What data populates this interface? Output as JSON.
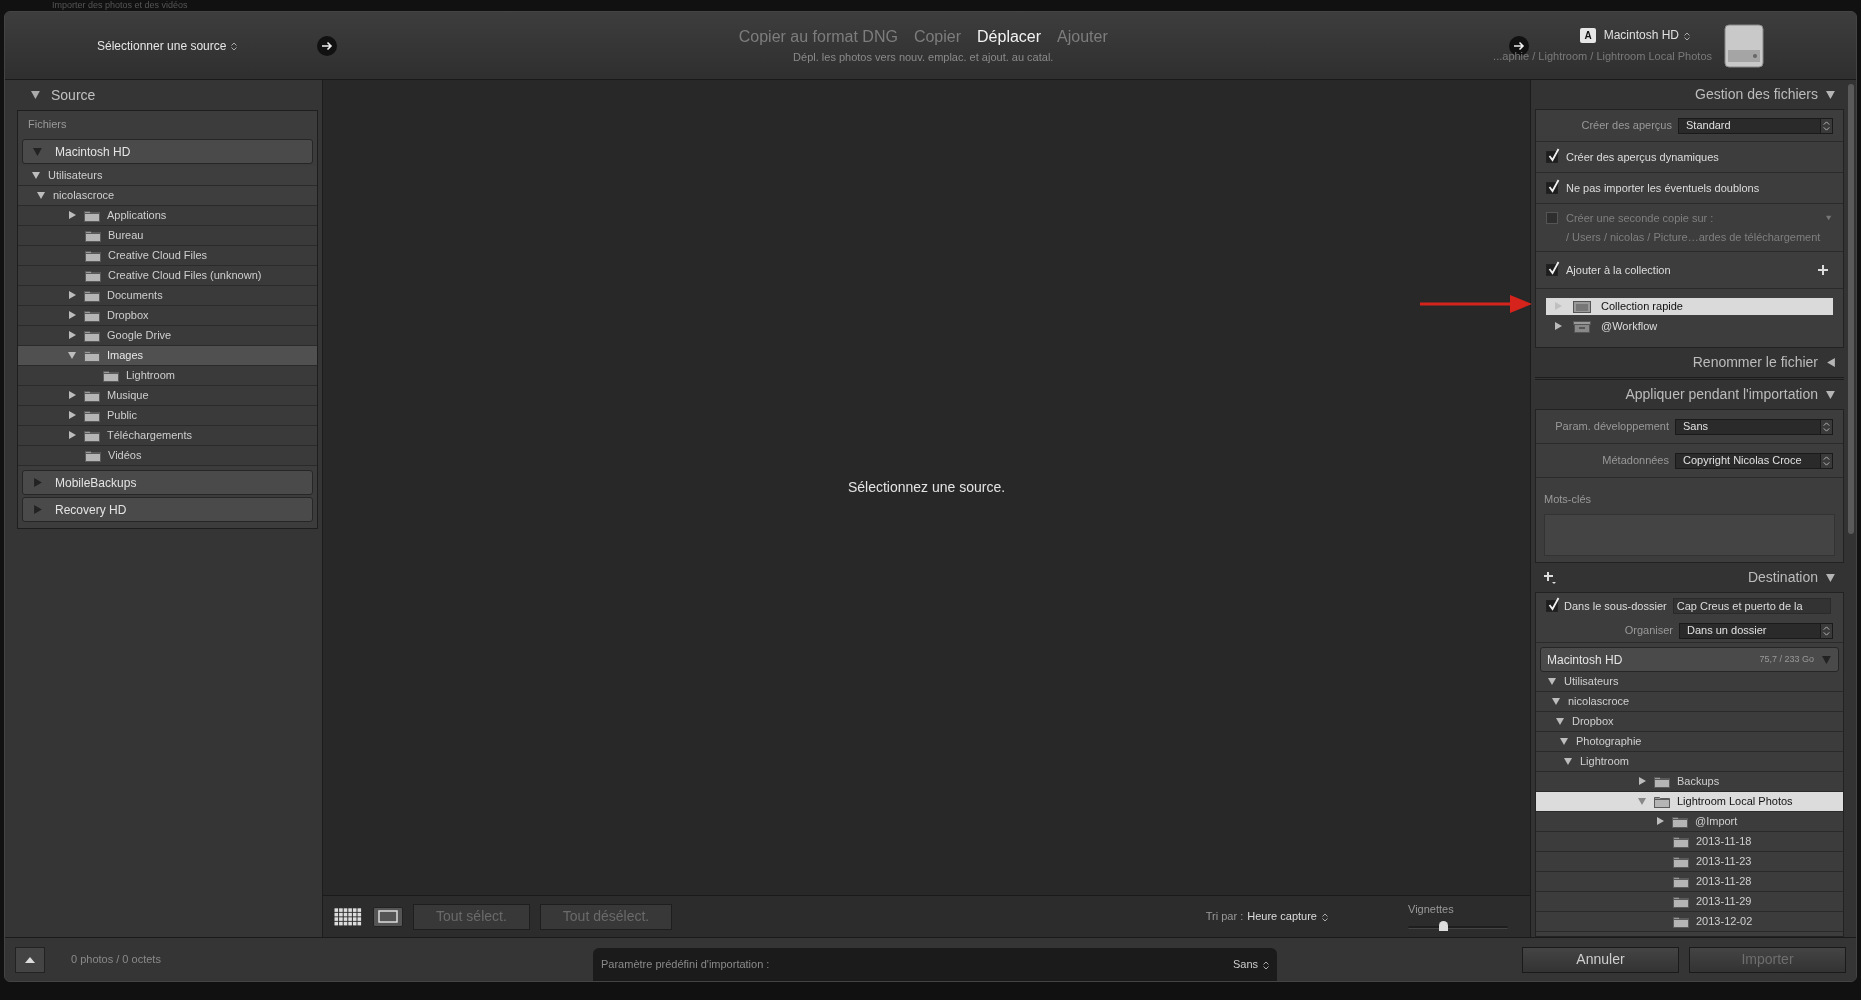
{
  "window": {
    "title": "Importer des photos et des vidéos"
  },
  "top_bar": {
    "source_selector": "Sélectionner une source",
    "modes": [
      {
        "label": "Copier au format DNG",
        "selected": false
      },
      {
        "label": "Copier",
        "selected": false
      },
      {
        "label": "Déplacer",
        "selected": true
      },
      {
        "label": "Ajouter",
        "selected": false
      }
    ],
    "mode_hint": "Dépl. les photos vers nouv. emplac. et ajout. au catal.",
    "drive_letter": "A",
    "destination_drive": "Macintosh HD",
    "destination_path": "...aphie / Lightroom / Lightroom Local Photos"
  },
  "source_panel": {
    "title": "Source",
    "section": "Fichiers",
    "volumes": [
      {
        "name": "Macintosh HD",
        "expanded": true,
        "children": [
          {
            "name": "Utilisateurs",
            "folder_icon": false,
            "expandable": true,
            "expanded": true,
            "selected": false,
            "children": [
              {
                "name": "nicolascroce",
                "folder_icon": false,
                "expandable": true,
                "expanded": true,
                "selected": false,
                "children": [
                  {
                    "name": "Applications",
                    "folder_icon": true,
                    "expandable": true,
                    "expanded": false,
                    "selected": false
                  },
                  {
                    "name": "Bureau",
                    "folder_icon": true,
                    "expandable": false,
                    "selected": false
                  },
                  {
                    "name": "Creative Cloud Files",
                    "folder_icon": true,
                    "expandable": false,
                    "selected": false
                  },
                  {
                    "name": "Creative Cloud Files (unknown)",
                    "folder_icon": true,
                    "expandable": false,
                    "selected": false
                  },
                  {
                    "name": "Documents",
                    "folder_icon": true,
                    "expandable": true,
                    "expanded": false,
                    "selected": false
                  },
                  {
                    "name": "Dropbox",
                    "folder_icon": true,
                    "expandable": true,
                    "expanded": false,
                    "selected": false
                  },
                  {
                    "name": "Google Drive",
                    "folder_icon": true,
                    "expandable": true,
                    "expanded": false,
                    "selected": false
                  },
                  {
                    "name": "Images",
                    "folder_icon": true,
                    "expandable": true,
                    "expanded": true,
                    "selected": true,
                    "children": [
                      {
                        "name": "Lightroom",
                        "folder_icon": true,
                        "expandable": false,
                        "selected": false
                      }
                    ]
                  },
                  {
                    "name": "Musique",
                    "folder_icon": true,
                    "expandable": true,
                    "expanded": false,
                    "selected": false
                  },
                  {
                    "name": "Public",
                    "folder_icon": true,
                    "expandable": true,
                    "expanded": false,
                    "selected": false
                  },
                  {
                    "name": "Téléchargements",
                    "folder_icon": true,
                    "expandable": true,
                    "expanded": false,
                    "selected": false
                  },
                  {
                    "name": "Vidéos",
                    "folder_icon": true,
                    "expandable": false,
                    "selected": false
                  }
                ]
              }
            ]
          }
        ]
      },
      {
        "name": "MobileBackups",
        "expanded": false
      },
      {
        "name": "Recovery HD",
        "expanded": false
      }
    ]
  },
  "center": {
    "message": "Sélectionnez une source."
  },
  "toolbar": {
    "views": [
      {
        "kind": "grid",
        "selected": true
      },
      {
        "kind": "loupe",
        "selected": false
      }
    ],
    "buttons": [
      {
        "label": "Tout sélect.",
        "disabled": true
      },
      {
        "label": "Tout désélect.",
        "disabled": true
      }
    ],
    "sort_label": "Tri par :",
    "sort_value": "Heure capture",
    "thumbnails_label": "Vignettes",
    "thumbnails": {
      "level": 0.35
    }
  },
  "file_handling": {
    "title": "Gestion des fichiers",
    "expanded": true,
    "previews_label": "Créer des aperçus",
    "previews_value": "Standard",
    "options": [
      {
        "label": "Créer des aperçus dynamiques",
        "checked": true,
        "disabled": false
      },
      {
        "label": "Ne pas importer les éventuels doublons",
        "checked": true,
        "disabled": false
      },
      {
        "label": "Créer une seconde copie sur :",
        "checked": false,
        "disabled": true,
        "path": "/ Users / nicolas / Picture…ardes de téléchargement"
      }
    ],
    "collection_label": "Ajouter à la collection",
    "collection_checked": true,
    "collections": [
      {
        "name": "Collection rapide",
        "kind": "quick",
        "expandable": false,
        "selected": true
      },
      {
        "name": "@Workflow",
        "kind": "set",
        "expandable": true,
        "selected": false
      }
    ]
  },
  "rename": {
    "title": "Renommer le fichier",
    "expanded": false
  },
  "apply": {
    "title": "Appliquer pendant l'importation",
    "expanded": true,
    "fields": [
      {
        "label": "Param. développement",
        "value": "Sans"
      },
      {
        "label": "Métadonnées",
        "value": "Copyright Nicolas Croce"
      }
    ],
    "keywords_label": "Mots-clés"
  },
  "destination": {
    "title": "Destination",
    "expanded": true,
    "subfolder_label": "Dans le sous-dossier",
    "subfolder_checked": true,
    "subfolder_value": "Cap Creus et puerto de la",
    "organize_label": "Organiser",
    "organize_value": "Dans un dossier",
    "volume": {
      "name": "Macintosh HD",
      "space": "75,7 / 233 Go",
      "children": [
        {
          "name": "Utilisateurs",
          "folder_icon": false,
          "expandable": true,
          "expanded": true,
          "selected": false,
          "children": [
            {
              "name": "nicolascroce",
              "folder_icon": false,
              "expandable": true,
              "expanded": true,
              "selected": false,
              "children": [
                {
                  "name": "Dropbox",
                  "folder_icon": false,
                  "expandable": true,
                  "expanded": true,
                  "selected": false,
                  "children": [
                    {
                      "name": "Photographie",
                      "folder_icon": false,
                      "expandable": true,
                      "expanded": true,
                      "selected": false,
                      "children": [
                        {
                          "name": "Lightroom",
                          "folder_icon": false,
                          "expandable": true,
                          "expanded": true,
                          "selected": false,
                          "children": [
                            {
                              "name": "Backups",
                              "folder_icon": true,
                              "expandable": true,
                              "expanded": false,
                              "selected": false
                            },
                            {
                              "name": "Lightroom Local Photos",
                              "folder_icon": true,
                              "expandable": true,
                              "expanded": true,
                              "selected": true,
                              "children": [
                                {
                                  "name": "@Import",
                                  "folder_icon": true,
                                  "expandable": true,
                                  "expanded": false,
                                  "selected": false
                                },
                                {
                                  "name": "2013-11-18",
                                  "folder_icon": true,
                                  "expandable": false,
                                  "selected": false
                                },
                                {
                                  "name": "2013-11-23",
                                  "folder_icon": true,
                                  "expandable": false,
                                  "selected": false
                                },
                                {
                                  "name": "2013-11-28",
                                  "folder_icon": true,
                                  "expandable": false,
                                  "selected": false
                                },
                                {
                                  "name": "2013-11-29",
                                  "folder_icon": true,
                                  "expandable": false,
                                  "selected": false
                                },
                                {
                                  "name": "2013-12-02",
                                  "folder_icon": true,
                                  "expandable": false,
                                  "selected": false
                                }
                              ]
                            }
                          ]
                        }
                      ]
                    }
                  ]
                }
              ]
            }
          ]
        }
      ]
    }
  },
  "bottom_bar": {
    "count": "0 photos / 0 octets",
    "preset_label": "Paramètre prédéfini d'importation :",
    "preset_value": "Sans",
    "buttons": [
      {
        "label": "Annuler",
        "disabled": false
      },
      {
        "label": "Importer",
        "disabled": true
      }
    ]
  }
}
